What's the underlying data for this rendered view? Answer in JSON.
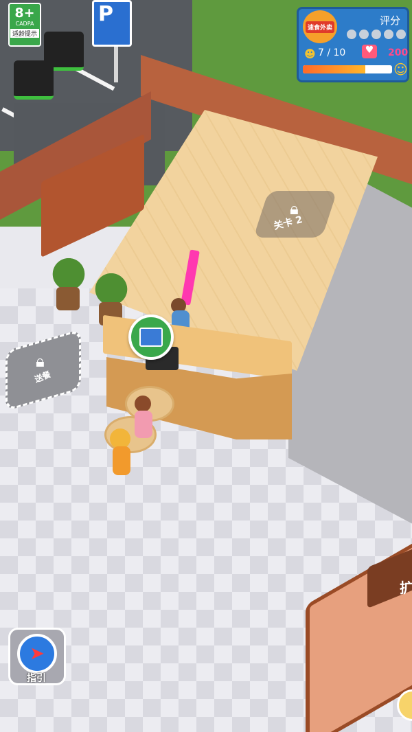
{
  "age_badge": {
    "rating": "8+",
    "org": "CADPA",
    "hint": "适龄提示"
  },
  "parking_sign": {
    "letter": "P"
  },
  "hud": {
    "logo_text": "速食外卖",
    "rating_label": "评分",
    "stars_filled": 0,
    "stars_total": 5,
    "staff": "7 / 10",
    "hearts": "200",
    "progress_fraction": 0.7,
    "icons": {
      "staff": "person-icon",
      "heart": "heart-icon",
      "smile": "smile-icon"
    }
  },
  "level_lock": {
    "label": "关卡 2"
  },
  "drive_lock": {
    "label": "送餐"
  },
  "guide": {
    "label": "指引"
  },
  "expand": {
    "label": "扩"
  },
  "colors": {
    "hud_bg": "#2d7cc9",
    "badge_green": "#3aa84b",
    "marker_pink": "#ff38b0"
  }
}
